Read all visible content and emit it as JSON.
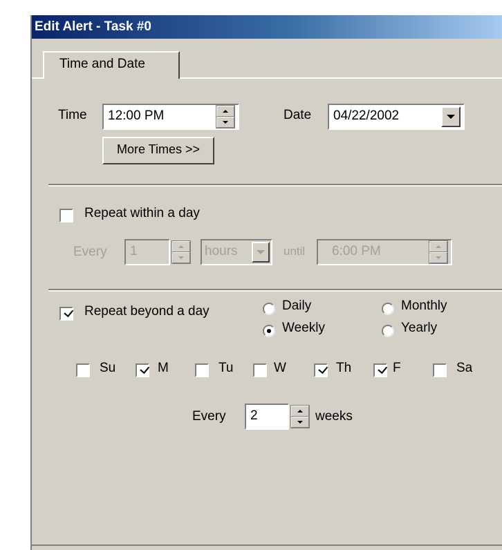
{
  "window": {
    "title": "Edit Alert - Task #0"
  },
  "tabs": [
    {
      "label": "Time and Date",
      "selected": true
    }
  ],
  "time_section": {
    "time_label": "Time",
    "time_value": "12:00 PM",
    "date_label": "Date",
    "date_value": "04/22/2002",
    "more_times_label": "More Times >>"
  },
  "repeat_within_day": {
    "label": "Repeat within a day",
    "checked": false,
    "every_label": "Every",
    "every_value": "1",
    "unit_value": "hours",
    "until_label": "until",
    "until_value": "6:00 PM"
  },
  "repeat_beyond_day": {
    "label": "Repeat beyond a day",
    "checked": true,
    "options": [
      {
        "label": "Daily",
        "selected": false
      },
      {
        "label": "Monthly",
        "selected": false
      },
      {
        "label": "Weekly",
        "selected": true
      },
      {
        "label": "Yearly",
        "selected": false
      }
    ],
    "days": [
      {
        "label": "Su",
        "checked": false
      },
      {
        "label": "M",
        "checked": true
      },
      {
        "label": "Tu",
        "checked": false
      },
      {
        "label": "W",
        "checked": false
      },
      {
        "label": "Th",
        "checked": true
      },
      {
        "label": "F",
        "checked": true
      },
      {
        "label": "Sa",
        "checked": false
      }
    ],
    "every_label": "Every",
    "every_value": "2",
    "unit_label": "weeks"
  },
  "colors": {
    "face": "#d4d0c8",
    "title_start": "#0a246a",
    "title_end": "#a6caf0",
    "disabled_text": "#a0a0a0"
  }
}
